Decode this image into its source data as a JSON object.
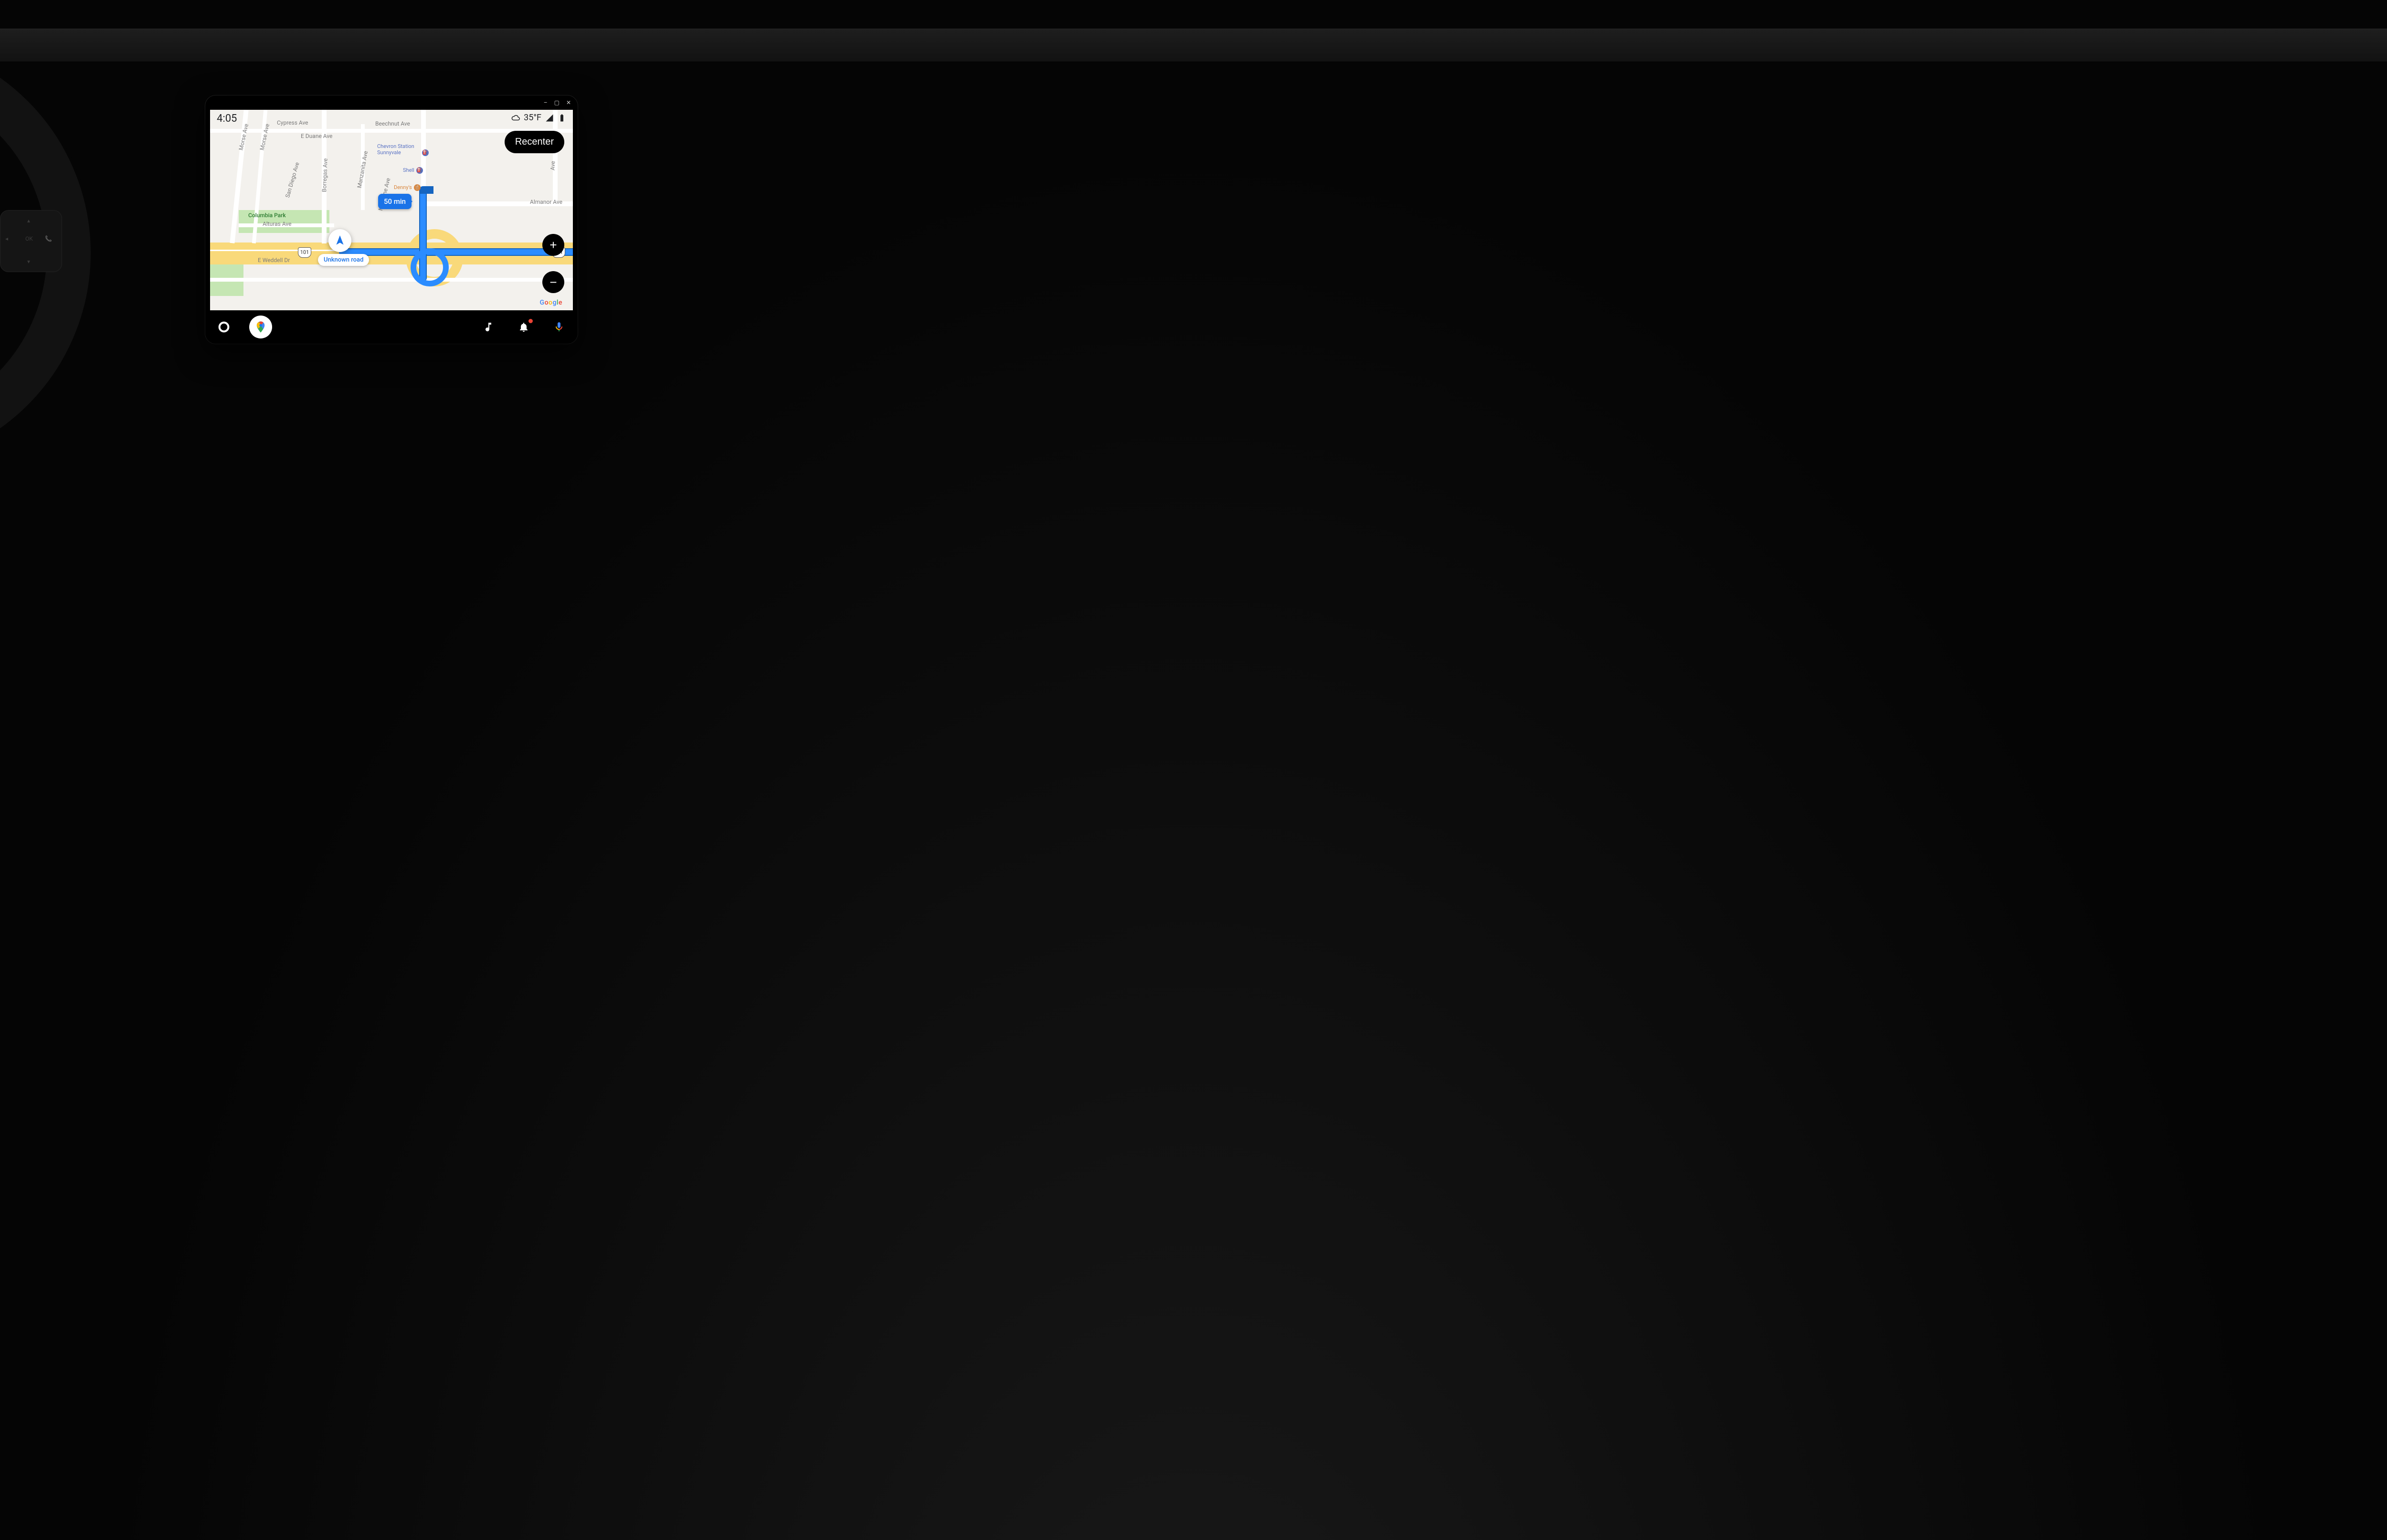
{
  "status": {
    "time": "4:05",
    "weather_icon": "cloud",
    "temperature": "35°F",
    "signal_icon": "cellular",
    "battery_icon": "battery"
  },
  "window_controls": {
    "minimize": "–",
    "maximize": "▢",
    "close": "✕"
  },
  "recenter_label": "Recenter",
  "zoom": {
    "in": "+",
    "out": "−"
  },
  "eta": "50 min",
  "current_road": "Unknown road",
  "map_brand": "Google",
  "map_labels": {
    "morse_ave_1": "Morse Ave",
    "morse_ave_2": "Morse Ave",
    "cypress_ave": "Cypress Ave",
    "e_duane_ave": "E Duane Ave",
    "san_diego_ave": "San Diego Ave",
    "borregas_ave": "Borregas Ave",
    "manzanita_ave": "Manzanita Ave",
    "madrone_ave": "Madrone Ave",
    "beechnut_ave": "Beechnut Ave",
    "almanor_ave": "Almanor Ave",
    "alturas_ave": "Alturas Ave",
    "e_weddell_dr": "E Weddell Dr",
    "columbia_park": "Columbia Park",
    "ave_right": "Ave"
  },
  "pois": {
    "chevron": "Chevron Station Sunnyvale",
    "shell": "Shell",
    "dennys": "Denny's"
  },
  "highway_shields": {
    "us101_left": "101",
    "us101_right": "101"
  },
  "navbar": {
    "launcher": "launcher",
    "maps": "Google Maps",
    "music": "music",
    "notifications": "notifications",
    "assistant": "assistant"
  }
}
